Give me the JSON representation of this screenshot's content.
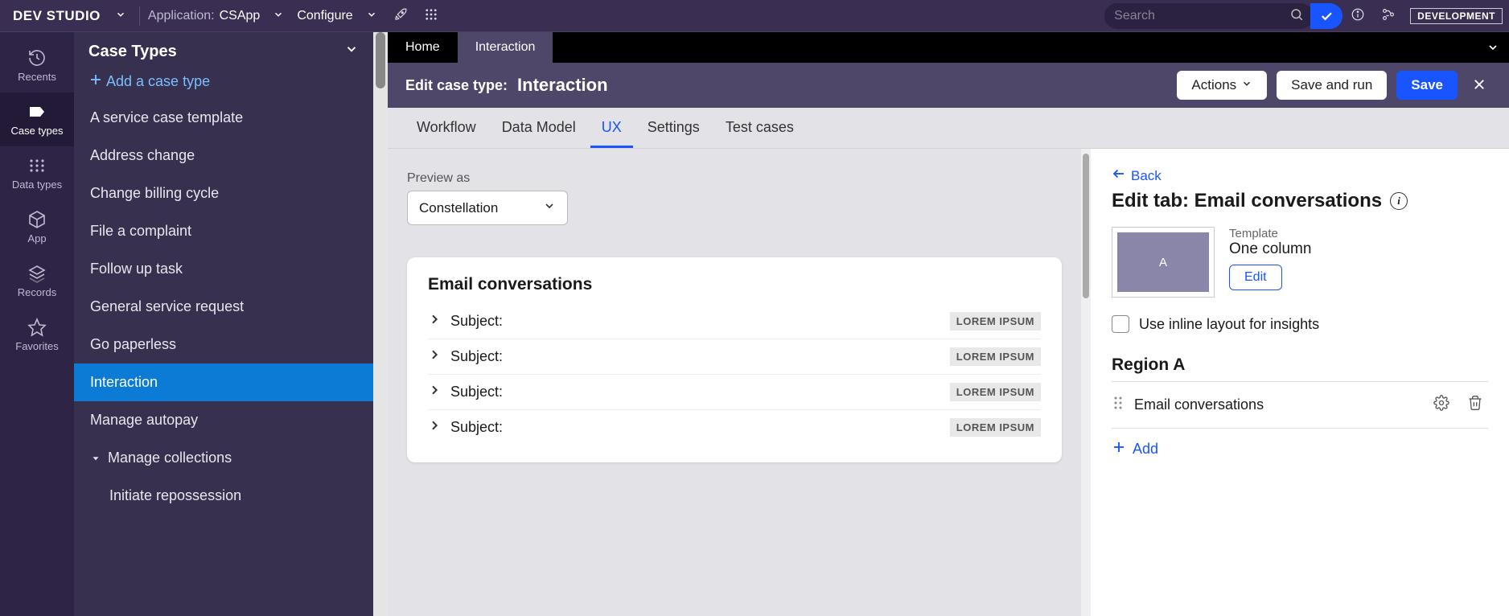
{
  "topbar": {
    "brand": "DEV STUDIO",
    "app_label": "Application:",
    "app_name": "CSApp",
    "configure": "Configure",
    "search_placeholder": "Search",
    "env_badge": "DEVELOPMENT"
  },
  "rail": [
    {
      "key": "recents",
      "label": "Recents"
    },
    {
      "key": "case-types",
      "label": "Case types"
    },
    {
      "key": "data-types",
      "label": "Data types"
    },
    {
      "key": "app",
      "label": "App"
    },
    {
      "key": "records",
      "label": "Records"
    },
    {
      "key": "favorites",
      "label": "Favorites"
    }
  ],
  "explorer": {
    "title": "Case Types",
    "add_label": "Add a case type",
    "items": [
      {
        "label": "A service case template"
      },
      {
        "label": "Address change"
      },
      {
        "label": "Change billing cycle"
      },
      {
        "label": "File a complaint"
      },
      {
        "label": "Follow up task"
      },
      {
        "label": "General service request"
      },
      {
        "label": "Go paperless"
      },
      {
        "label": "Interaction",
        "selected": true
      },
      {
        "label": "Manage autopay"
      },
      {
        "label": "Manage collections",
        "expandable": true
      },
      {
        "label": "Initiate repossession",
        "sub": true
      }
    ]
  },
  "tabs": {
    "home": "Home",
    "interaction": "Interaction"
  },
  "editheader": {
    "label": "Edit case type:",
    "name": "Interaction",
    "actions": "Actions",
    "save_run": "Save and run",
    "save": "Save"
  },
  "subtabs": [
    {
      "label": "Workflow"
    },
    {
      "label": "Data Model"
    },
    {
      "label": "UX",
      "active": true
    },
    {
      "label": "Settings"
    },
    {
      "label": "Test cases"
    }
  ],
  "preview": {
    "label": "Preview as",
    "value": "Constellation",
    "card_title": "Email conversations",
    "subject_label": "Subject:",
    "lorem": "LOREM IPSUM",
    "rows": 4
  },
  "inspector": {
    "back": "Back",
    "title": "Edit tab: Email conversations",
    "template_label": "Template",
    "template_value": "One column",
    "template_letter": "A",
    "edit": "Edit",
    "inline_label": "Use inline layout for insights",
    "region_title": "Region A",
    "region_item": "Email conversations",
    "add": "Add"
  }
}
